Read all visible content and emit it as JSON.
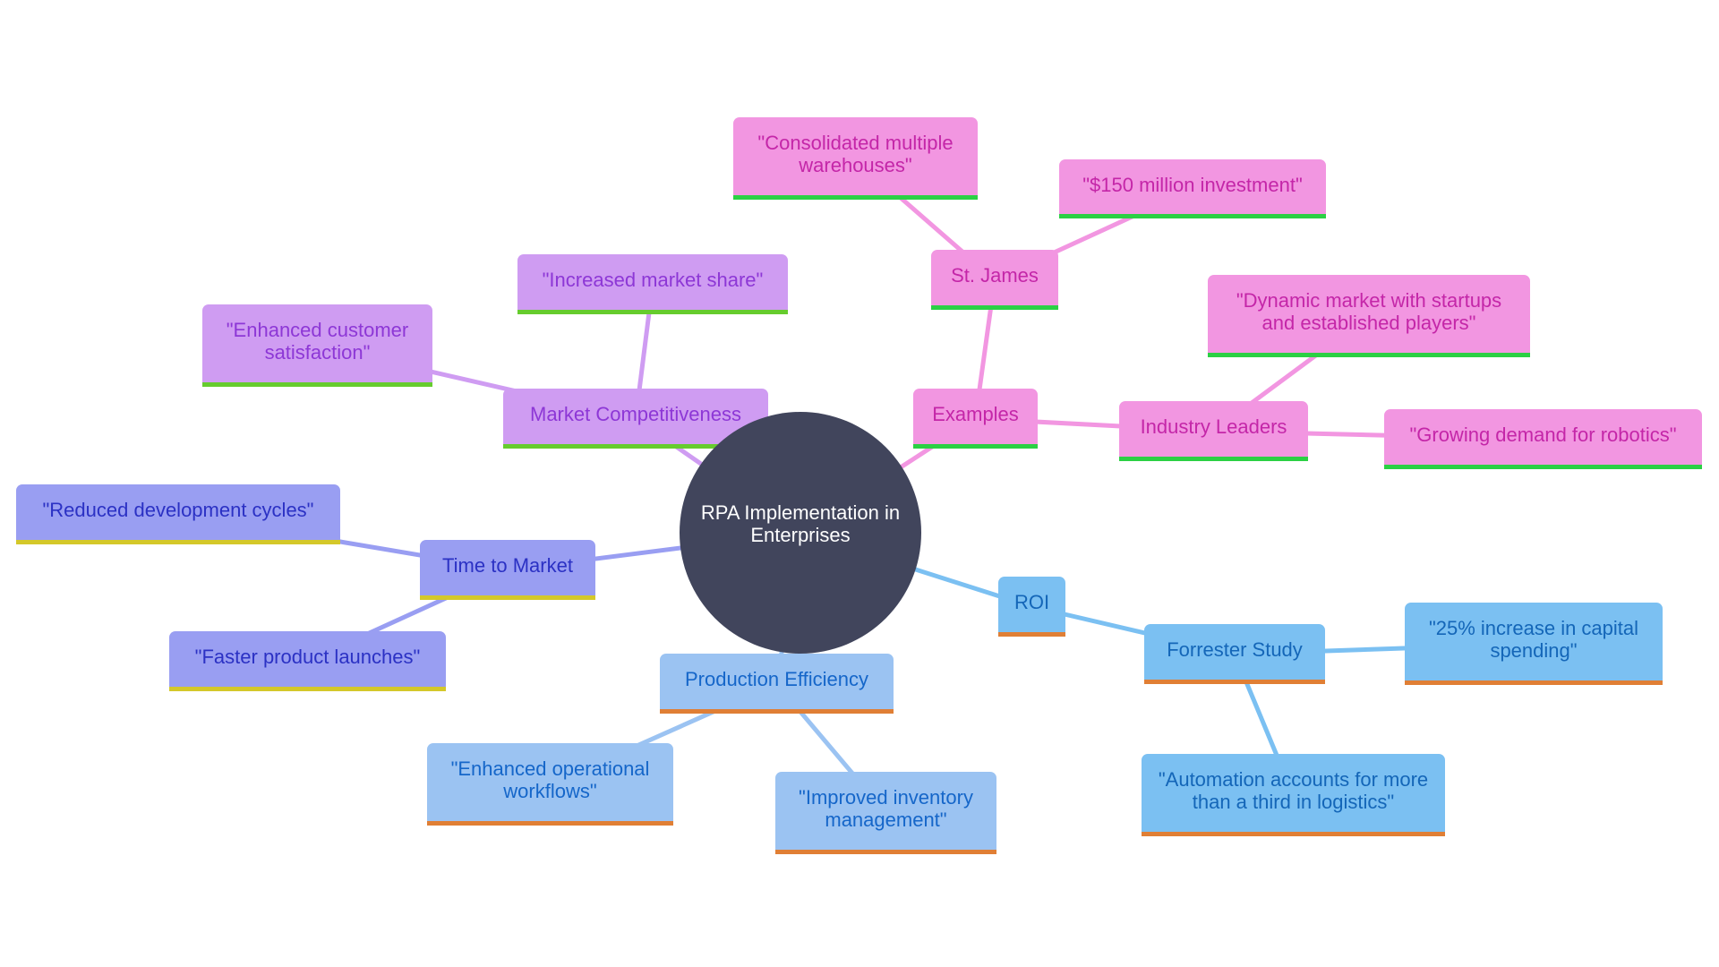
{
  "title": "RPA Implementation in Enterprises",
  "colors": {
    "center": "#41455c",
    "examples_branch": "#f296e1",
    "market_branch": "#cf9cf2",
    "time_branch": "#999ef2",
    "production_branch": "#9bc3f2",
    "roi_branch": "#7bc0f2"
  },
  "nodes": {
    "center": "RPA Implementation in Enterprises",
    "examples": "Examples",
    "st_james": "St. James",
    "consolidated": "\"Consolidated multiple warehouses\"",
    "investment": "\"$150 million investment\"",
    "industry_leaders": "Industry Leaders",
    "dynamic_market": "\"Dynamic market with startups and established players\"",
    "growing_demand": "\"Growing demand for robotics\"",
    "market_competitiveness": "Market Competitiveness",
    "market_share": "\"Increased market share\"",
    "customer_satisfaction": "\"Enhanced customer satisfaction\"",
    "time_to_market": "Time to Market",
    "reduced_cycles": "\"Reduced development cycles\"",
    "faster_launches": "\"Faster product launches\"",
    "production_efficiency": "Production Efficiency",
    "operational_workflows": "\"Enhanced operational workflows\"",
    "inventory_management": "\"Improved inventory management\"",
    "roi": "ROI",
    "forrester": "Forrester Study",
    "capital_spending": "\"25% increase in capital spending\"",
    "logistics": "\"Automation accounts for more than a third in logistics\""
  },
  "edges": [
    [
      "center",
      "examples"
    ],
    [
      "examples",
      "st_james"
    ],
    [
      "st_james",
      "consolidated"
    ],
    [
      "st_james",
      "investment"
    ],
    [
      "examples",
      "industry_leaders"
    ],
    [
      "industry_leaders",
      "dynamic_market"
    ],
    [
      "industry_leaders",
      "growing_demand"
    ],
    [
      "center",
      "market_competitiveness"
    ],
    [
      "market_competitiveness",
      "market_share"
    ],
    [
      "market_competitiveness",
      "customer_satisfaction"
    ],
    [
      "center",
      "time_to_market"
    ],
    [
      "time_to_market",
      "reduced_cycles"
    ],
    [
      "time_to_market",
      "faster_launches"
    ],
    [
      "center",
      "production_efficiency"
    ],
    [
      "production_efficiency",
      "operational_workflows"
    ],
    [
      "production_efficiency",
      "inventory_management"
    ],
    [
      "center",
      "roi"
    ],
    [
      "roi",
      "forrester"
    ],
    [
      "forrester",
      "capital_spending"
    ],
    [
      "forrester",
      "logistics"
    ]
  ]
}
